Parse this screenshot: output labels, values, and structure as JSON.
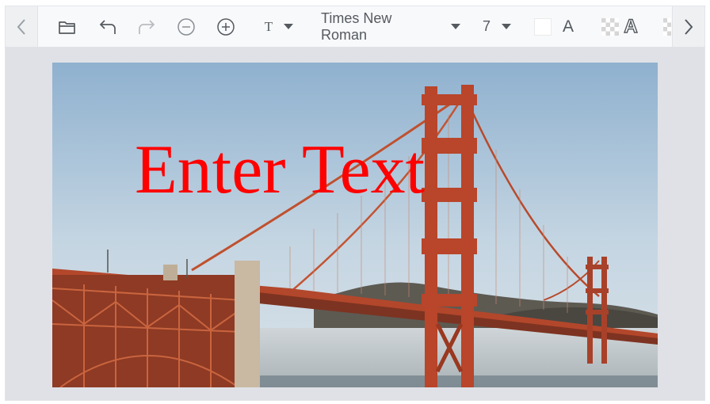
{
  "toolbar": {
    "prev_icon": "chevron-left-icon",
    "next_icon": "chevron-right-icon",
    "open_icon": "folder-open-icon",
    "undo_icon": "undo-icon",
    "redo_icon": "redo-icon",
    "zoom_out_icon": "zoom-out-icon",
    "zoom_in_icon": "zoom-in-icon",
    "text_tool_glyph": "T",
    "font_family": "Times New Roman",
    "font_size": "7",
    "font_color": "#ffffff",
    "stroke_glyph": "A",
    "outline_glyph": "A"
  },
  "canvas": {
    "overlay_text": "Enter Text",
    "overlay_color": "#ff0000"
  }
}
